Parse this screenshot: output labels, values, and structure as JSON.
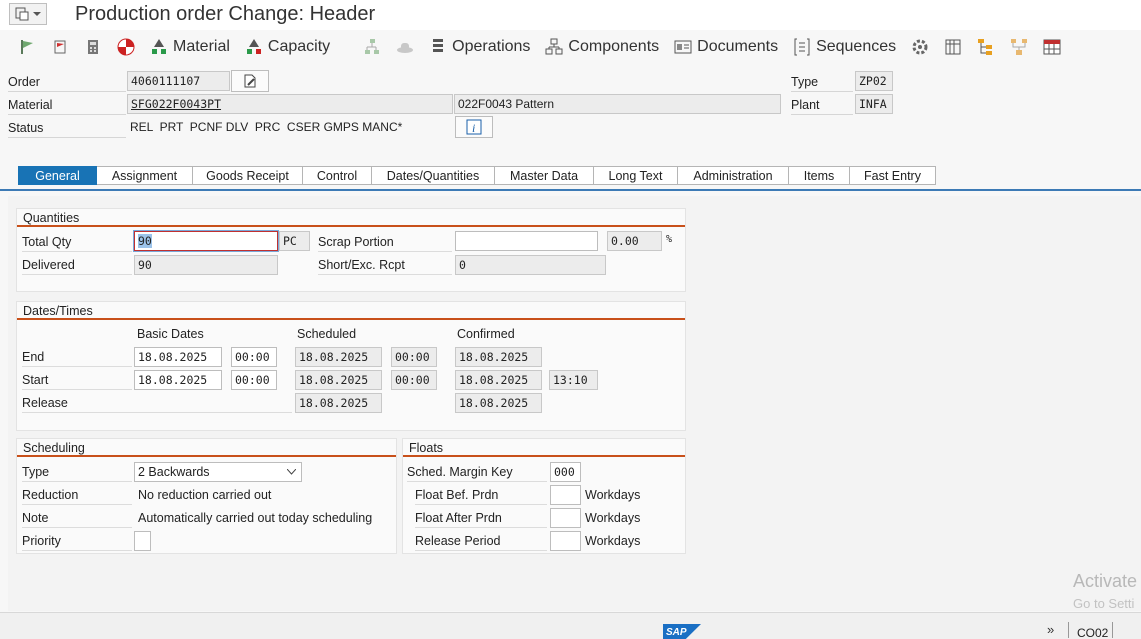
{
  "title": "Production order Change: Header",
  "toolbar": {
    "material": "Material",
    "capacity": "Capacity",
    "operations": "Operations",
    "components": "Components",
    "documents": "Documents",
    "sequences": "Sequences"
  },
  "header": {
    "order_label": "Order",
    "order_value": "4060111107",
    "material_label": "Material",
    "material_value": "SFG022F0043PT",
    "material_desc": "022F0043 Pattern",
    "status_label": "Status",
    "status_value": "REL  PRT  PCNF DLV  PRC  CSER GMPS MANC*",
    "type_label": "Type",
    "type_value": "ZP02",
    "plant_label": "Plant",
    "plant_value": "INFA"
  },
  "tabs": [
    "General",
    "Assignment",
    "Goods Receipt",
    "Control",
    "Dates/Quantities",
    "Master Data",
    "Long Text",
    "Administration",
    "Items",
    "Fast Entry"
  ],
  "quantities": {
    "title": "Quantities",
    "total_qty_label": "Total Qty",
    "total_qty_value": "90",
    "unit": "PC",
    "scrap_label": "Scrap Portion",
    "scrap_value": "",
    "scrap_pct": "0.00",
    "pct_sign": "%",
    "delivered_label": "Delivered",
    "delivered_value": "90",
    "short_label": "Short/Exc. Rcpt",
    "short_value": "0"
  },
  "dates": {
    "title": "Dates/Times",
    "col_basic": "Basic Dates",
    "col_sched": "Scheduled",
    "col_conf": "Confirmed",
    "end_label": "End",
    "start_label": "Start",
    "release_label": "Release",
    "end_basic_date": "18.08.2025",
    "end_basic_time": "00:00",
    "end_sched_date": "18.08.2025",
    "end_sched_time": "00:00",
    "end_conf_date": "18.08.2025",
    "start_basic_date": "18.08.2025",
    "start_basic_time": "00:00",
    "start_sched_date": "18.08.2025",
    "start_sched_time": "00:00",
    "start_conf_date": "18.08.2025",
    "start_conf_time": "13:10",
    "release_sched_date": "18.08.2025",
    "release_conf_date": "18.08.2025"
  },
  "scheduling": {
    "title": "Scheduling",
    "type_label": "Type",
    "type_value": "2 Backwards",
    "reduction_label": "Reduction",
    "reduction_value": "No reduction carried out",
    "note_label": "Note",
    "note_value": "Automatically carried out today scheduling",
    "priority_label": "Priority",
    "priority_value": ""
  },
  "floats": {
    "title": "Floats",
    "margin_key_label": "Sched. Margin Key",
    "margin_key_value": "000",
    "float_bef_label": "Float Bef. Prdn",
    "float_after_label": "Float After Prdn",
    "release_period_label": "Release Period",
    "unit": "Workdays"
  },
  "footer": {
    "transaction": "CO02",
    "watermark_line1": "Activate",
    "watermark_line2": "Go to Setti"
  },
  "colors": {
    "accent_tab": "#1873b5",
    "section_rule": "#c8501a"
  }
}
